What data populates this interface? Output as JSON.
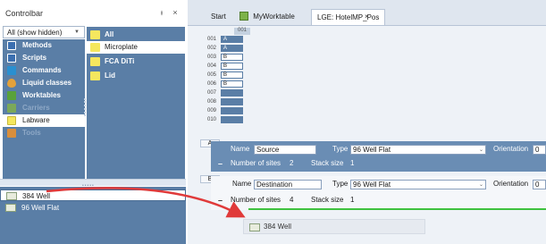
{
  "controlbar": {
    "title": "Controlbar",
    "pin_icon": "pin-icon",
    "close_icon": "close-icon",
    "filter_value": "All (show hidden)",
    "categories": [
      {
        "label": "Methods",
        "icon": "methods-icon",
        "color": "#3b6fb0"
      },
      {
        "label": "Scripts",
        "icon": "scripts-icon",
        "color": "#3b6fb0"
      },
      {
        "label": "Commands",
        "icon": "commands-icon",
        "color": "#2a8fd0"
      },
      {
        "label": "Liquid classes",
        "icon": "liquid-icon",
        "color": "#e3a13a"
      },
      {
        "label": "Worktables",
        "icon": "worktable-icon",
        "color": "#59a23a"
      },
      {
        "label": "Carriers",
        "icon": "carrier-icon",
        "color": "#7ba85a"
      },
      {
        "label": "Labware",
        "icon": "labware-icon",
        "color": "#f5e75e"
      },
      {
        "label": "Tools",
        "icon": "tools-icon",
        "color": "#d98e3c"
      }
    ],
    "items": [
      {
        "label": "All"
      },
      {
        "label": "Microplate"
      },
      {
        "label": "FCA DiTi"
      },
      {
        "label": "Lid"
      }
    ],
    "list": [
      {
        "label": "384 Well"
      },
      {
        "label": "96 Well Flat"
      }
    ]
  },
  "tabs": [
    {
      "label": "Start"
    },
    {
      "label": "MyWorktable"
    },
    {
      "label": "LGE: HotelMP_Pos"
    }
  ],
  "tab_close": "×",
  "carrier": {
    "header": "001",
    "slots": [
      {
        "num": "001",
        "label": "A"
      },
      {
        "num": "002",
        "label": "A"
      },
      {
        "num": "003",
        "label": "B"
      },
      {
        "num": "004",
        "label": "B"
      },
      {
        "num": "005",
        "label": "B"
      },
      {
        "num": "006",
        "label": "B"
      },
      {
        "num": "007",
        "label": ""
      },
      {
        "num": "008",
        "label": ""
      },
      {
        "num": "009",
        "label": ""
      },
      {
        "num": "010",
        "label": ""
      }
    ]
  },
  "site_a": {
    "tag": "A",
    "name_label": "Name",
    "name_value": "Source",
    "type_label": "Type",
    "type_value": "96 Well Flat",
    "orientation_label": "Orientation",
    "orientation_value": "0",
    "sites_label": "Number of sites",
    "sites_value": "2",
    "stack_label": "Stack size",
    "stack_value": "1"
  },
  "site_b": {
    "tag": "B",
    "name_label": "Name",
    "name_value": "Destination",
    "type_label": "Type",
    "type_value": "96 Well Flat",
    "orientation_label": "Orientation",
    "orientation_value": "0",
    "sites_label": "Number of sites",
    "sites_value": "4",
    "stack_label": "Stack size",
    "stack_value": "1"
  },
  "drag_ghost": {
    "label": "384 Well"
  },
  "colors": {
    "arrow": "#e03a3a",
    "drop_line": "#3fc23f",
    "panel": "#5a7ea6"
  }
}
